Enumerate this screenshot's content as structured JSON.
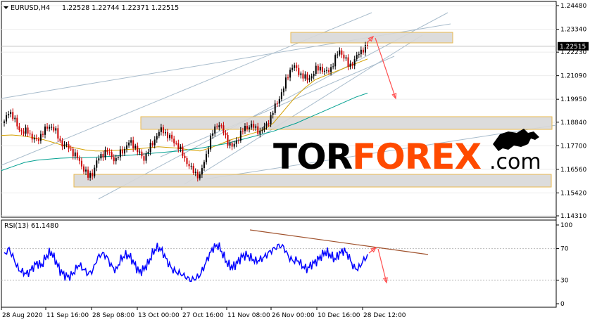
{
  "header": {
    "symbol": "EURUSD,H4",
    "ohlc": "1.22528 1.22744 1.22371 1.22515"
  },
  "rsi_header": "RSI(13) 61.1480",
  "watermark": {
    "part1": "TOR",
    "part2": "FOREX",
    "suffix": ".com",
    "color_dark": "#000000",
    "color_accent": "#ff4a00"
  },
  "colors": {
    "candle_up": "#000000",
    "candle_down": "#cc0000",
    "ma_fast": "#d4a000",
    "ma_slow": "#00a090",
    "rsi_line": "#0000ff",
    "channel": "#a8bccc",
    "zone_fill": "#d9d9d9",
    "zone_border": "#e8b23a",
    "arrow": "#ff5050",
    "rsi_trend": "#a0522d"
  },
  "current_price_label": "1.22515",
  "chart_data": [
    {
      "type": "line",
      "title": "",
      "x_ticks": [
        "28 Aug 2020",
        "11 Sep 16:00",
        "28 Sep 08:00",
        "13 Oct 00:00",
        "27 Oct 16:00",
        "11 Nov 08:00",
        "26 Nov 00:00",
        "10 Dec 16:00",
        "28 Dec 12:00"
      ],
      "y_ticks": [
        "1.24480",
        "1.23340",
        "1.22230",
        "1.21090",
        "1.19950",
        "1.18840",
        "1.17700",
        "1.16560",
        "1.15420",
        "1.14310"
      ],
      "ylim": [
        1.1431,
        1.2448
      ],
      "current_price": 1.22515,
      "series": [
        {
          "values": [
            1.188,
            1.1945,
            1.19,
            1.186,
            1.183,
            1.1845,
            1.181,
            1.179,
            1.183,
            1.185,
            1.187,
            1.184,
            1.179,
            1.177,
            1.176,
            1.173,
            1.17,
            1.166,
            1.162,
            1.164,
            1.17,
            1.173,
            1.1745,
            1.172,
            1.17,
            1.174,
            1.176,
            1.179,
            1.177,
            1.173,
            1.171,
            1.175,
            1.179,
            1.183,
            1.185,
            1.182,
            1.18,
            1.178,
            1.174,
            1.17,
            1.166,
            1.164,
            1.162,
            1.17,
            1.178,
            1.185,
            1.188,
            1.184,
            1.179,
            1.176,
            1.18,
            1.184,
            1.186,
            1.187,
            1.185,
            1.184,
            1.186,
            1.19,
            1.195,
            1.2,
            1.205,
            1.212,
            1.216,
            1.213,
            1.211,
            1.209,
            1.211,
            1.214,
            1.215,
            1.212,
            1.214,
            1.219,
            1.223,
            1.22,
            1.215,
            1.218,
            1.221,
            1.224,
            1.2251
          ]
        }
      ],
      "ma_fast": [
        1.182,
        1.1822,
        1.1818,
        1.181,
        1.18,
        1.1785,
        1.177,
        1.176,
        1.175,
        1.1745,
        1.1745,
        1.1748,
        1.1752,
        1.1755,
        1.176,
        1.1765,
        1.1762,
        1.1758,
        1.175,
        1.1745,
        1.176,
        1.178,
        1.18,
        1.1815,
        1.183,
        1.1845,
        1.188,
        1.194,
        1.2,
        1.205,
        1.209,
        1.211,
        1.213,
        1.215,
        1.217,
        1.219
      ],
      "ma_slow": [
        1.165,
        1.167,
        1.169,
        1.17,
        1.1705,
        1.171,
        1.1712,
        1.1712,
        1.1715,
        1.1718,
        1.1722,
        1.1725,
        1.173,
        1.1735,
        1.174,
        1.1745,
        1.1752,
        1.176,
        1.177,
        1.178,
        1.1795,
        1.181,
        1.1825,
        1.184,
        1.186,
        1.188,
        1.1905,
        1.193,
        1.1955,
        1.198,
        1.2005,
        1.2025
      ]
    },
    {
      "type": "line",
      "title": "",
      "y_ticks": [
        "100",
        "70",
        "30",
        "0"
      ],
      "ylim": [
        0,
        100
      ],
      "series": [
        {
          "values": [
            62,
            70,
            58,
            44,
            40,
            38,
            45,
            52,
            48,
            60,
            66,
            55,
            42,
            36,
            34,
            40,
            50,
            44,
            38,
            42,
            58,
            64,
            60,
            48,
            42,
            56,
            62,
            60,
            50,
            40,
            44,
            52,
            66,
            72,
            66,
            54,
            44,
            40,
            38,
            34,
            30,
            32,
            36,
            48,
            62,
            72,
            74,
            62,
            50,
            46,
            52,
            60,
            62,
            58,
            54,
            56,
            60,
            66,
            70,
            74,
            72,
            60,
            54,
            56,
            48,
            44,
            50,
            54,
            60,
            66,
            62,
            56,
            64,
            68,
            60,
            46,
            44,
            54,
            61
          ]
        }
      ]
    }
  ]
}
